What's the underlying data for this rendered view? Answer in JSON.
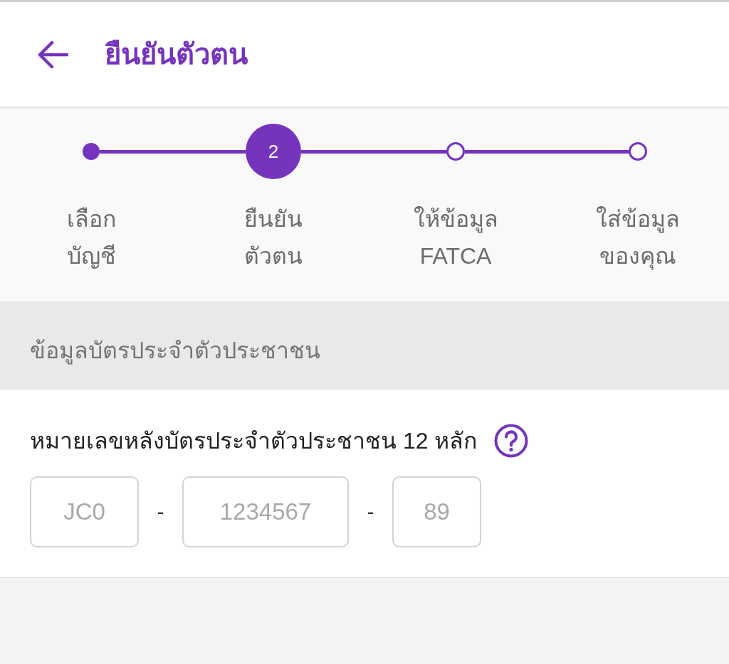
{
  "header": {
    "title": "ยืนยันตัวตน"
  },
  "stepper": {
    "steps": [
      {
        "kind": "done",
        "label_lines": [
          "เลือก",
          "บัญชี"
        ]
      },
      {
        "kind": "current",
        "number": "2",
        "label_lines": [
          "ยืนยัน",
          "ตัวตน"
        ]
      },
      {
        "kind": "upcoming",
        "label_lines": [
          "ให้ข้อมูล",
          "FATCA"
        ]
      },
      {
        "kind": "upcoming",
        "label_lines": [
          "ใส่ข้อมูล",
          "ของคุณ"
        ]
      }
    ]
  },
  "section": {
    "title": "ข้อมูลบัตรประจำตัวประชาชน"
  },
  "id_field": {
    "label": "หมายเลขหลังบัตรประจำตัวประชาชน 12 หลัก",
    "parts": [
      {
        "kind": "input",
        "placeholder": "JC0"
      },
      {
        "kind": "separator",
        "text": "-"
      },
      {
        "kind": "input",
        "placeholder": "1234567"
      },
      {
        "kind": "separator",
        "text": "-"
      },
      {
        "kind": "input",
        "placeholder": "89"
      }
    ]
  }
}
